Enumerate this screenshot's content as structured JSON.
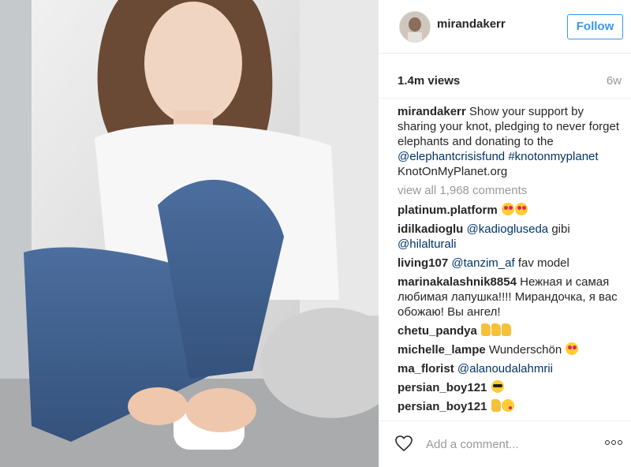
{
  "post": {
    "username": "mirandakerr",
    "follow_label": "Follow",
    "views": "1.4m views",
    "age": "6w",
    "caption": {
      "user": "mirandakerr",
      "text": "Show your support by sharing your knot, pledging to never forget elephants and donating to the",
      "mention": "@elephantcrisisfund",
      "hashtag": "#knotonmyplanet",
      "site": "KnotOnMyPlanet.org"
    },
    "view_all": "view all 1,968 comments"
  },
  "comments": [
    {
      "user": "platinum.platform",
      "text": ""
    },
    {
      "user": "idilkadioglu",
      "mention": "@kadiogluseda",
      "text": "gibi",
      "mention2": "@hilalturali"
    },
    {
      "user": "living107",
      "mention": "@tanzim_af",
      "text": "fav model"
    },
    {
      "user": "marinakalashnik8854",
      "text": "Нежная и самая любимая лапушка!!!! Мирандочка, я вас обожаю! Вы ангел!"
    },
    {
      "user": "chetu_pandya",
      "text": ""
    },
    {
      "user": "michelle_lampe",
      "text": "Wunderschön"
    },
    {
      "user": "ma_florist",
      "mention": "@alanoudalahmrii",
      "text": ""
    },
    {
      "user": "persian_boy121",
      "text": ""
    },
    {
      "user": "persian_boy121",
      "text": ""
    }
  ],
  "footer": {
    "comment_placeholder": "Add a comment..."
  },
  "colors": {
    "accent": "#3897f0",
    "link": "#003569",
    "muted": "#999999"
  },
  "icons": [
    "heart-icon",
    "more-options-icon"
  ]
}
